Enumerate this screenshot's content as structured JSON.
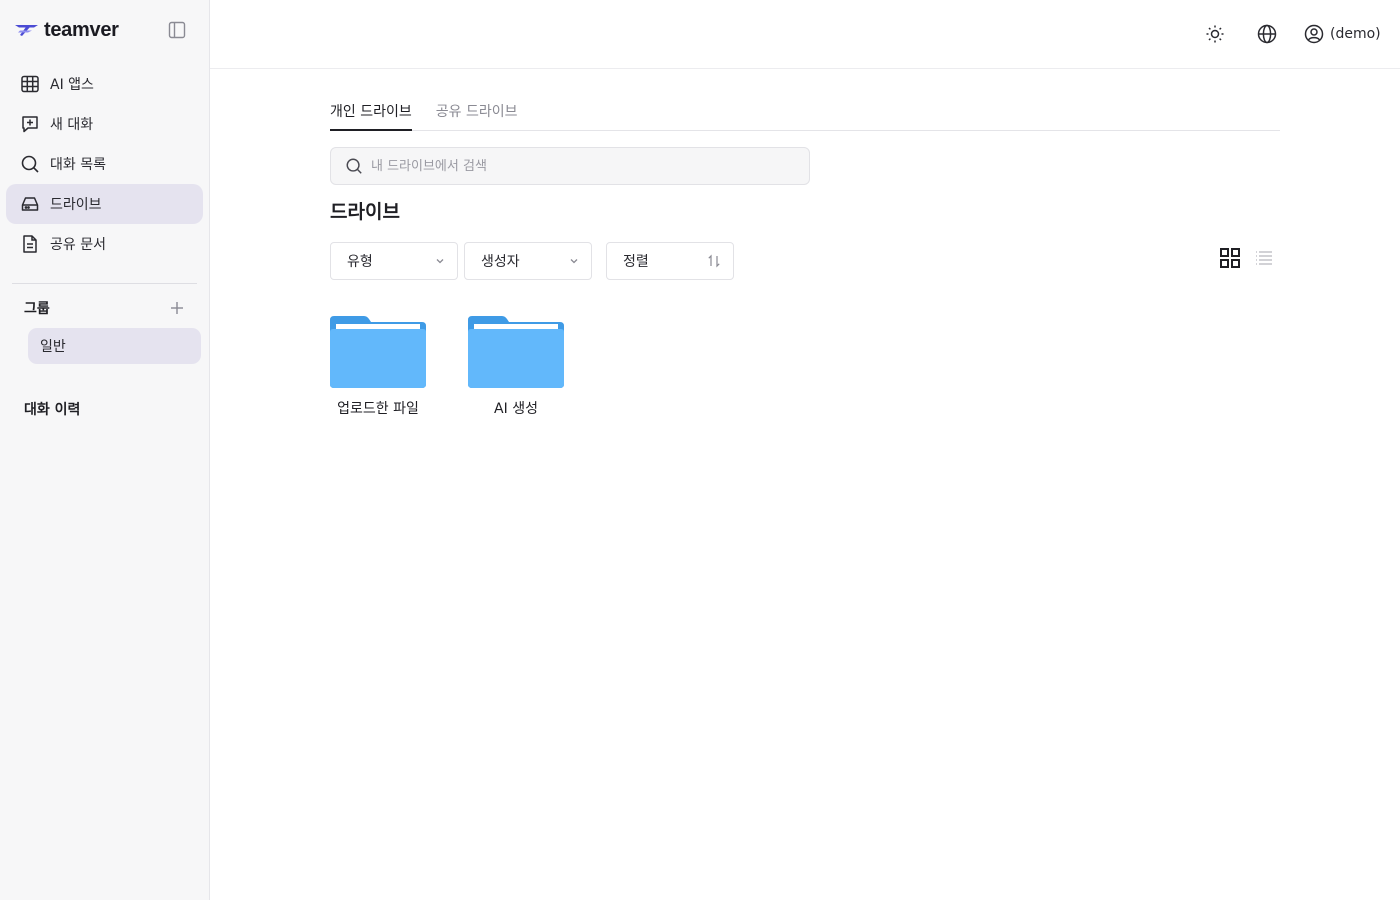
{
  "brand": {
    "name": "teamver"
  },
  "sidebar": {
    "items": [
      {
        "label": "AI 앱스",
        "icon": "grid-icon"
      },
      {
        "label": "새 대화",
        "icon": "new-chat-icon"
      },
      {
        "label": "대화 목록",
        "icon": "search-icon"
      },
      {
        "label": "드라이브",
        "icon": "drive-icon",
        "active": true
      },
      {
        "label": "공유 문서",
        "icon": "document-icon"
      }
    ],
    "group_title": "그룹",
    "group_items": [
      {
        "label": "일반"
      }
    ],
    "history_title": "대화 이력"
  },
  "topbar": {
    "user_label": "(demo)"
  },
  "main": {
    "tabs": [
      {
        "label": "개인 드라이브",
        "active": true
      },
      {
        "label": "공유 드라이브",
        "active": false
      }
    ],
    "search": {
      "placeholder": "내 드라이브에서 검색",
      "value": ""
    },
    "title": "드라이브",
    "filters": {
      "type": "유형",
      "creator": "생성자",
      "sort": "정렬"
    },
    "view_mode": "grid",
    "folders": [
      {
        "label": "업로드한 파일"
      },
      {
        "label": "AI 생성"
      }
    ]
  },
  "colors": {
    "accent_purple": "#5b5bd6",
    "active_bg": "#e5e3ef",
    "folder_back": "#3f9be6",
    "folder_front": "#62b8fb"
  }
}
